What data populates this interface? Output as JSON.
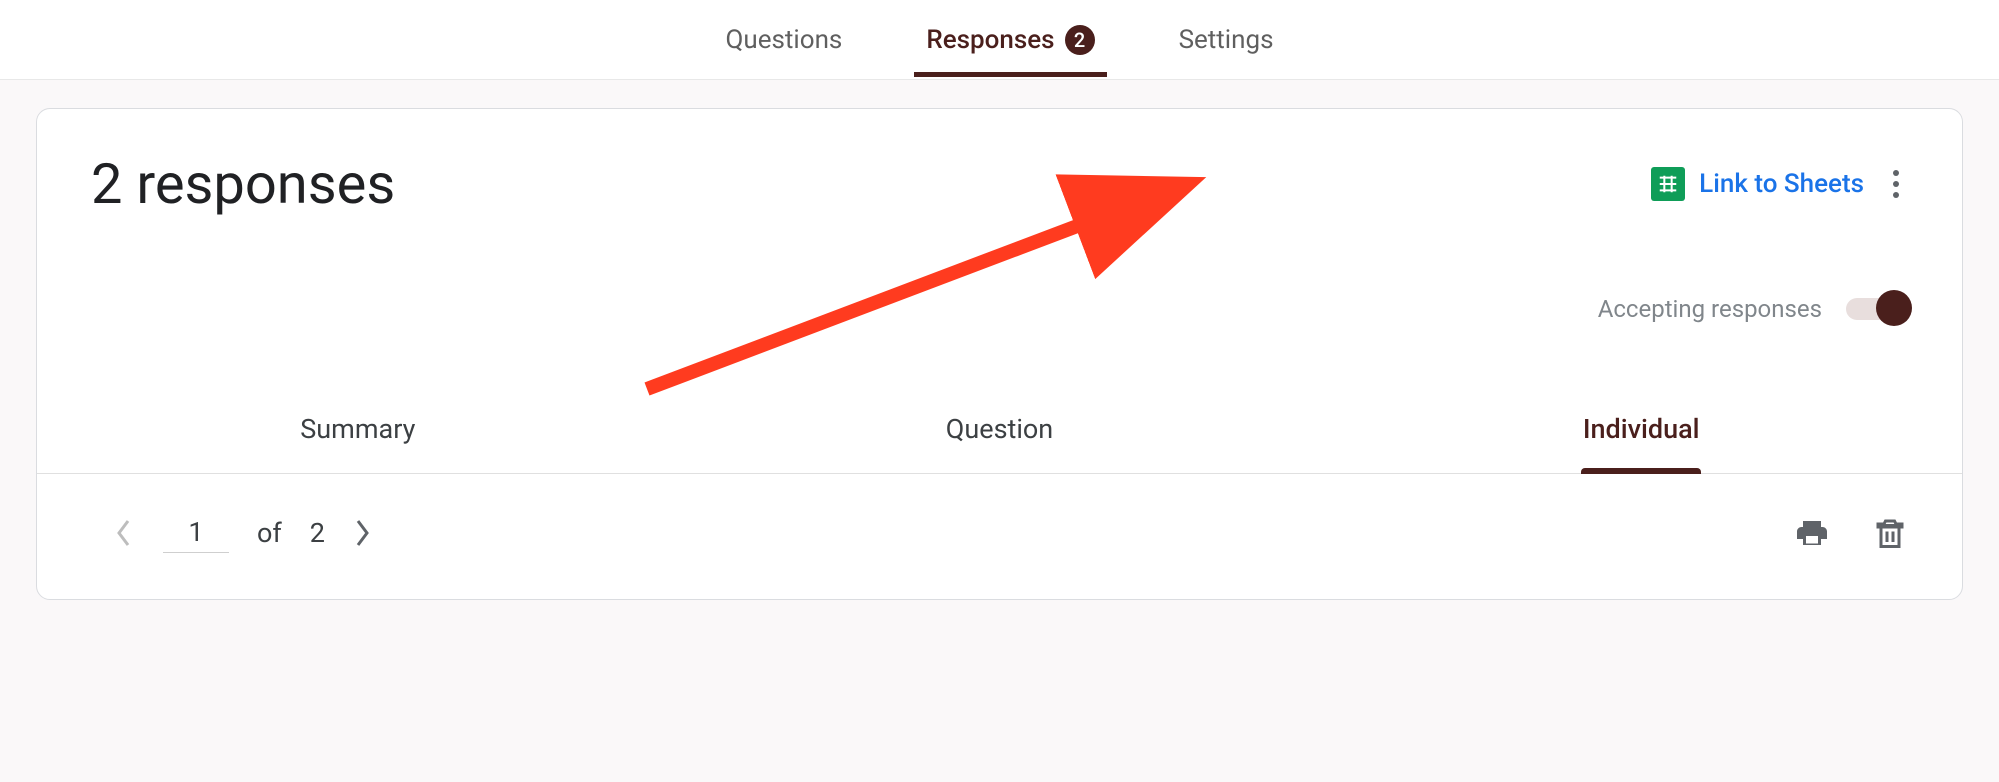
{
  "topTabs": {
    "questions": "Questions",
    "responses": "Responses",
    "responsesBadge": "2",
    "settings": "Settings"
  },
  "card": {
    "title": "2 responses",
    "linkToSheets": "Link to Sheets",
    "acceptingLabel": "Accepting responses"
  },
  "subTabs": {
    "summary": "Summary",
    "question": "Question",
    "individual": "Individual"
  },
  "pager": {
    "current": "1",
    "ofLabel": "of",
    "total": "2"
  }
}
